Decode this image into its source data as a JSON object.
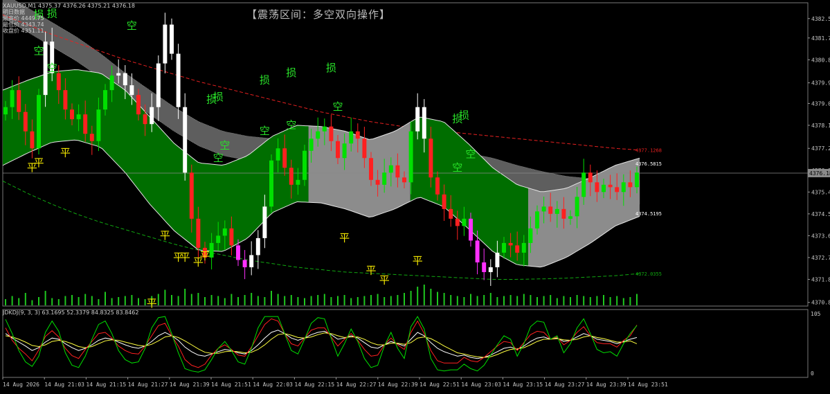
{
  "header": {
    "symbol_line": "XAUUSD,M1  4375.37 4376.26 4375.21 4376.18",
    "info_title": "明日数据",
    "info_lines": [
      "最高价 4449.75",
      "最低价 4343.74",
      "收盘价 4351.11"
    ],
    "title": "【震荡区间：多空双向操作】"
  },
  "colors": {
    "background": "#000000",
    "bull": "#00e000",
    "bear": "#ff2020",
    "band_green": "#006e00",
    "band_gray": "#8c8c8c",
    "gray_channel": "#6e6e6e",
    "upper_ma": "#e82020",
    "lower_ma": "#10a810",
    "label_green": "#29e329",
    "label_yellow": "#f2e600",
    "stoch_k": "#ffffff",
    "stoch_d": "#ffff40",
    "stoch_j": "#ff2020",
    "stoch_x": "#00e000"
  },
  "chart_data": [
    {
      "type": "candlestick",
      "title": "【震荡区间：多空双向操作】",
      "symbol": "XAUUSD,M1",
      "ylim": [
        4370.7,
        4383.2
      ],
      "y_ticks": [
        "4382.55",
        "4381.75",
        "4380.85",
        "4379.90",
        "4379.05",
        "4378.15",
        "4377.20",
        "4376.30",
        "4375.40",
        "4374.50",
        "4373.60",
        "4372.70",
        "4371.80",
        "4370.85"
      ],
      "x_labels": [
        "14 Aug 2026",
        "14 Aug 21:03",
        "14 Aug 21:15",
        "14 Aug 21:27",
        "14 Aug 21:39",
        "14 Aug 21:51",
        "14 Aug 22:03",
        "14 Aug 22:15",
        "14 Aug 22:27",
        "14 Aug 22:39",
        "14 Aug 22:51",
        "14 Aug 23:03",
        "14 Aug 23:15",
        "14 Aug 23:27",
        "14 Aug 23:39",
        "14 Aug 23:51"
      ],
      "current_price": "4376.18",
      "level_labels": [
        {
          "text": "4377.1268",
          "price": 4377.13,
          "color": "#e82020"
        },
        {
          "text": "4376.5815",
          "price": 4376.58,
          "color": "#ffffff"
        },
        {
          "text": "4374.5195",
          "price": 4374.52,
          "color": "#ffffff"
        },
        {
          "text": "4372.0355",
          "price": 4372.04,
          "color": "#10a810"
        }
      ],
      "band_upper": [
        4379.6,
        4380.0,
        4380.35,
        4380.45,
        4380.3,
        4379.6,
        4378.5,
        4377.4,
        4376.6,
        4376.5,
        4376.9,
        4377.7,
        4378.15,
        4378.1,
        4377.9,
        4377.55,
        4377.9,
        4378.5,
        4378.3,
        4377.4,
        4376.4,
        4375.7,
        4375.4,
        4375.55,
        4376.0,
        4376.5,
        4376.8
      ],
      "band_lower": [
        4376.5,
        4377.0,
        4377.45,
        4377.55,
        4377.25,
        4376.2,
        4374.9,
        4373.8,
        4373.0,
        4372.95,
        4373.5,
        4374.55,
        4375.0,
        4374.95,
        4374.7,
        4374.35,
        4374.7,
        4375.2,
        4374.8,
        4373.9,
        4372.95,
        4372.4,
        4372.3,
        4372.7,
        4373.3,
        4374.0,
        4374.4
      ],
      "gray_channel_upper": [
        4383.6,
        4383.0,
        4382.4,
        4381.8,
        4381.1,
        4380.3,
        4379.6,
        4378.9,
        4378.3,
        4377.9,
        4377.7,
        4377.6,
        4377.5,
        4377.4,
        4377.3,
        4377.3,
        4377.35,
        4377.35,
        4377.25,
        4377.0,
        4376.8,
        4376.5,
        4376.25,
        4376.05,
        4375.95,
        4375.9,
        4375.9
      ],
      "gray_channel_lower": [
        4382.6,
        4382.0,
        4381.4,
        4380.8,
        4380.1,
        4379.3,
        4378.6,
        4377.9,
        4377.3,
        4376.9,
        4376.7,
        4376.6,
        4376.5,
        4376.4,
        4376.3,
        4376.3,
        4376.35,
        4376.35,
        4376.25,
        4376.0,
        4375.8,
        4375.5,
        4375.25,
        4375.05,
        4374.95,
        4374.9,
        4374.9
      ],
      "upper_ma": [
        4382.7,
        4382.3,
        4381.9,
        4381.55,
        4381.2,
        4380.85,
        4380.55,
        4380.25,
        4379.95,
        4379.7,
        4379.45,
        4379.2,
        4378.95,
        4378.7,
        4378.5,
        4378.3,
        4378.15,
        4378.0,
        4377.9,
        4377.8,
        4377.7,
        4377.6,
        4377.5,
        4377.4,
        4377.3,
        4377.2,
        4377.13
      ],
      "lower_ma": [
        4375.85,
        4375.35,
        4374.9,
        4374.5,
        4374.15,
        4373.85,
        4373.55,
        4373.25,
        4373.0,
        4372.8,
        4372.6,
        4372.45,
        4372.3,
        4372.2,
        4372.1,
        4372.05,
        4372.0,
        4371.95,
        4371.9,
        4371.85,
        4371.8,
        4371.8,
        4371.82,
        4371.85,
        4371.9,
        4371.95,
        4372.04
      ],
      "band_segments": [
        {
          "from": 0,
          "to": 0.48,
          "fill": "green"
        },
        {
          "from": 0.48,
          "to": 0.64,
          "fill": "gray"
        },
        {
          "from": 0.64,
          "to": 0.825,
          "fill": "green"
        },
        {
          "from": 0.825,
          "to": 1,
          "fill": "gray"
        }
      ],
      "candle_path": [
        4378.9,
        4379.6,
        4378.7,
        4377.9,
        4377.2,
        4379.4,
        4381.6,
        4380.3,
        4379.6,
        4378.8,
        4378.4,
        4378.6,
        4377.8,
        4377.5,
        4378.8,
        4379.6,
        4380.2,
        4380.3,
        4379.8,
        4379.4,
        4378.6,
        4378.2,
        4378.9,
        4380.7,
        4382.3,
        4381.1,
        4378.9,
        4376.2,
        4374.3,
        4373.1,
        4372.7,
        4373.3,
        4373.6,
        4373.9,
        4373.2,
        4372.6,
        4372.3,
        4372.8,
        4373.5,
        4374.8,
        4376.7,
        4377.2,
        4376.4,
        4375.7,
        4375.9,
        4377.1,
        4377.6,
        4377.9,
        4378.1,
        4377.5,
        4376.8,
        4377.4,
        4377.9,
        4377.6,
        4376.8,
        4375.9,
        4375.7,
        4376.2,
        4376.5,
        4376.0,
        4375.8,
        4377.9,
        4378.9,
        4377.6,
        4376.0,
        4375.3,
        4374.7,
        4374.3,
        4374.0,
        4374.3,
        4373.4,
        4372.5,
        4372.1,
        4372.3,
        4372.9,
        4373.3,
        4373.2,
        4372.9,
        4373.3,
        4373.9,
        4374.6,
        4374.8,
        4374.5,
        4374.7,
        4374.3,
        4374.4,
        4375.2,
        4376.2,
        4375.8,
        4375.4,
        4375.7,
        4375.6,
        4375.4,
        4375.8,
        4375.6,
        4376.2
      ],
      "volumes": [
        6,
        9,
        7,
        12,
        5,
        8,
        14,
        7,
        6,
        9,
        10,
        8,
        11,
        9,
        6,
        13,
        7,
        8,
        9,
        10,
        7,
        6,
        9,
        11,
        15,
        10,
        9,
        16,
        11,
        12,
        8,
        10,
        9,
        7,
        11,
        8,
        10,
        12,
        9,
        8,
        14,
        11,
        9,
        10,
        8,
        7,
        9,
        10,
        11,
        8,
        9,
        10,
        7,
        8,
        9,
        10,
        11,
        8,
        9,
        10,
        12,
        14,
        18,
        20,
        16,
        13,
        12,
        10,
        9,
        8,
        11,
        9,
        10,
        12,
        8,
        9,
        10,
        9,
        11,
        10,
        8,
        9,
        10,
        7,
        9,
        8,
        10,
        9,
        8,
        9,
        10,
        8,
        9,
        7,
        8,
        11
      ],
      "signal_labels": [
        {
          "text": "损",
          "i": 5,
          "price": 4382.7,
          "color": "#29e329"
        },
        {
          "text": "损",
          "i": 7,
          "price": 4382.75,
          "color": "#29e329"
        },
        {
          "text": "空",
          "i": 5,
          "price": 4381.2,
          "color": "#29e329"
        },
        {
          "text": "空",
          "i": 7,
          "price": 4380.5,
          "color": "#29e329"
        },
        {
          "text": "平",
          "i": 4,
          "price": 4376.4,
          "color": "#f2e600"
        },
        {
          "text": "平",
          "i": 5,
          "price": 4376.6,
          "color": "#f2e600"
        },
        {
          "text": "平",
          "i": 9,
          "price": 4377.0,
          "color": "#f2e600"
        },
        {
          "text": "空",
          "i": 19,
          "price": 4382.25,
          "color": "#29e329"
        },
        {
          "text": "平",
          "i": 22,
          "price": 4370.8,
          "color": "#f2e600"
        },
        {
          "text": "平",
          "i": 24,
          "price": 4373.6,
          "color": "#f2e600"
        },
        {
          "text": "平",
          "i": 26,
          "price": 4372.7,
          "color": "#f2e600"
        },
        {
          "text": "平",
          "i": 27,
          "price": 4372.7,
          "color": "#f2e600"
        },
        {
          "text": "平",
          "i": 29,
          "price": 4372.5,
          "color": "#f2e600"
        },
        {
          "text": "平",
          "i": 30,
          "price": 4372.75,
          "color": "#f2e600"
        },
        {
          "text": "损",
          "i": 31,
          "price": 4379.2,
          "color": "#29e329"
        },
        {
          "text": "损",
          "i": 32,
          "price": 4379.3,
          "color": "#29e329"
        },
        {
          "text": "空",
          "i": 32,
          "price": 4376.8,
          "color": "#29e329"
        },
        {
          "text": "空",
          "i": 33,
          "price": 4377.3,
          "color": "#29e329"
        },
        {
          "text": "损",
          "i": 39,
          "price": 4380.0,
          "color": "#29e329"
        },
        {
          "text": "空",
          "i": 39,
          "price": 4377.9,
          "color": "#29e329"
        },
        {
          "text": "损",
          "i": 43,
          "price": 4380.3,
          "color": "#29e329"
        },
        {
          "text": "空",
          "i": 43,
          "price": 4378.15,
          "color": "#29e329"
        },
        {
          "text": "损",
          "i": 49,
          "price": 4380.5,
          "color": "#29e329"
        },
        {
          "text": "空",
          "i": 50,
          "price": 4378.9,
          "color": "#29e329"
        },
        {
          "text": "平",
          "i": 51,
          "price": 4373.5,
          "color": "#f2e600"
        },
        {
          "text": "平",
          "i": 55,
          "price": 4372.15,
          "color": "#f2e600"
        },
        {
          "text": "平",
          "i": 57,
          "price": 4371.75,
          "color": "#f2e600"
        },
        {
          "text": "平",
          "i": 62,
          "price": 4372.55,
          "color": "#f2e600"
        },
        {
          "text": "损",
          "i": 68,
          "price": 4378.4,
          "color": "#29e329"
        },
        {
          "text": "损",
          "i": 69,
          "price": 4378.55,
          "color": "#29e329"
        },
        {
          "text": "空",
          "i": 68,
          "price": 4376.4,
          "color": "#29e329"
        },
        {
          "text": "空",
          "i": 70,
          "price": 4376.95,
          "color": "#29e329"
        }
      ]
    },
    {
      "type": "line",
      "title": "JDKDJ(9, 3, 3) 63.1695 52.3379 84.8325 83.8462",
      "ylim": [
        0,
        105
      ],
      "y_ticks": [
        "105",
        "0"
      ],
      "series": [
        {
          "name": "K",
          "color": "#ffffff",
          "values": [
            70,
            62,
            55,
            48,
            40,
            45,
            55,
            62,
            60,
            52,
            45,
            40,
            44,
            50,
            58,
            62,
            60,
            55,
            50,
            46,
            44,
            48,
            56,
            66,
            72,
            66,
            58,
            46,
            38,
            32,
            30,
            34,
            38,
            42,
            40,
            36,
            34,
            40,
            50,
            62,
            72,
            76,
            70,
            62,
            58,
            62,
            68,
            72,
            74,
            68,
            60,
            62,
            66,
            62,
            54,
            46,
            44,
            50,
            56,
            52,
            48,
            60,
            72,
            66,
            54,
            44,
            38,
            34,
            30,
            32,
            28,
            26,
            28,
            32,
            38,
            44,
            46,
            42,
            48,
            56,
            62,
            64,
            60,
            62,
            56,
            58,
            64,
            70,
            66,
            60,
            58,
            56,
            52,
            56,
            60,
            63
          ]
        },
        {
          "name": "D",
          "color": "#ffff40",
          "values": [
            66,
            64,
            60,
            55,
            49,
            47,
            50,
            56,
            58,
            56,
            52,
            47,
            45,
            47,
            52,
            57,
            59,
            58,
            55,
            52,
            49,
            48,
            51,
            57,
            64,
            66,
            63,
            57,
            50,
            43,
            37,
            35,
            35,
            38,
            39,
            38,
            36,
            37,
            42,
            50,
            60,
            68,
            70,
            67,
            63,
            62,
            64,
            68,
            71,
            70,
            66,
            63,
            64,
            64,
            60,
            54,
            50,
            50,
            53,
            53,
            51,
            54,
            62,
            64,
            61,
            55,
            48,
            42,
            36,
            34,
            31,
            29,
            28,
            29,
            33,
            38,
            42,
            43,
            45,
            50,
            56,
            60,
            60,
            61,
            59,
            58,
            60,
            64,
            66,
            63,
            61,
            58,
            55,
            55,
            57,
            52
          ]
        },
        {
          "name": "J",
          "color": "#ff2020",
          "values": [
            80,
            58,
            44,
            34,
            22,
            41,
            65,
            75,
            64,
            44,
            31,
            26,
            42,
            56,
            70,
            72,
            62,
            48,
            40,
            35,
            34,
            48,
            66,
            84,
            88,
            66,
            48,
            24,
            14,
            10,
            16,
            32,
            44,
            50,
            42,
            32,
            30,
            46,
            66,
            86,
            96,
            92,
            70,
            52,
            48,
            62,
            76,
            80,
            80,
            64,
            48,
            60,
            70,
            58,
            42,
            30,
            32,
            50,
            62,
            50,
            42,
            72,
            92,
            70,
            40,
            22,
            18,
            18,
            18,
            28,
            22,
            20,
            28,
            38,
            48,
            56,
            54,
            40,
            54,
            68,
            74,
            72,
            60,
            64,
            50,
            58,
            72,
            82,
            66,
            54,
            52,
            52,
            46,
            58,
            66,
            85
          ]
        },
        {
          "name": "X",
          "color": "#00e000",
          "values": [
            95,
            70,
            40,
            20,
            12,
            30,
            72,
            92,
            74,
            36,
            14,
            10,
            30,
            60,
            86,
            92,
            70,
            40,
            24,
            18,
            20,
            44,
            80,
            98,
            100,
            70,
            36,
            8,
            4,
            2,
            6,
            24,
            44,
            56,
            40,
            20,
            16,
            44,
            80,
            100,
            100,
            100,
            70,
            40,
            34,
            60,
            88,
            98,
            96,
            62,
            30,
            52,
            78,
            56,
            26,
            10,
            14,
            48,
            72,
            44,
            26,
            82,
            100,
            78,
            26,
            6,
            4,
            6,
            6,
            16,
            8,
            4,
            14,
            32,
            50,
            66,
            60,
            30,
            52,
            82,
            92,
            90,
            60,
            66,
            36,
            52,
            80,
            96,
            70,
            42,
            36,
            38,
            30,
            52,
            70,
            84
          ]
        }
      ]
    }
  ]
}
